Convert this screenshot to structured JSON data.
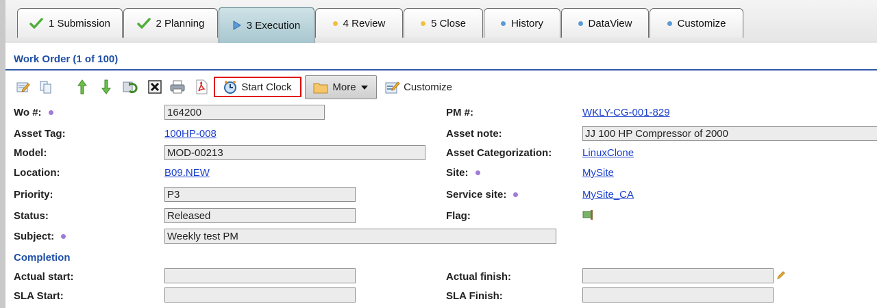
{
  "tabs": [
    {
      "label": "1 Submission",
      "icon": "check-icon",
      "state": "done"
    },
    {
      "label": "2 Planning",
      "icon": "check-icon",
      "state": "done"
    },
    {
      "label": "3 Execution",
      "icon": "play-icon",
      "state": "active"
    },
    {
      "label": "4 Review",
      "icon": "yellow-dot-icon",
      "state": "pending"
    },
    {
      "label": "5 Close",
      "icon": "yellow-dot-icon",
      "state": "pending"
    },
    {
      "label": "History",
      "icon": "blue-dot-icon",
      "state": "info"
    },
    {
      "label": "DataView",
      "icon": "blue-dot-icon",
      "state": "info"
    },
    {
      "label": "Customize",
      "icon": "blue-dot-icon",
      "state": "info"
    }
  ],
  "section_title": "Work Order (1 of 100)",
  "toolbar": {
    "icons": [
      "edit-icon",
      "copy-icon",
      "move-up-icon",
      "move-down-icon",
      "refresh-icon",
      "delete-icon",
      "print-icon",
      "pdf-icon"
    ],
    "start_clock_label": "Start Clock",
    "more_label": "More",
    "customize_label": "Customize"
  },
  "form": {
    "wo_label": "Wo #:",
    "wo_value": "164200",
    "pm_label": "PM #:",
    "pm_value": "WKLY-CG-001-829",
    "asset_tag_label": "Asset Tag:",
    "asset_tag_value": "100HP-008",
    "asset_note_label": "Asset note:",
    "asset_note_value": "JJ 100 HP Compressor of 2000",
    "model_label": "Model:",
    "model_value": "MOD-00213",
    "asset_cat_label": "Asset Categorization:",
    "asset_cat_value": "LinuxClone",
    "location_label": "Location:",
    "location_value": "B09.NEW",
    "site_label": "Site:",
    "site_value": "MySite",
    "priority_label": "Priority:",
    "priority_value": "P3",
    "service_site_label": "Service site:",
    "service_site_value": "MySite_CA",
    "status_label": "Status:",
    "status_value": "Released",
    "flag_label": "Flag:",
    "subject_label": "Subject:",
    "subject_value": "Weekly test PM"
  },
  "completion": {
    "title": "Completion",
    "actual_start_label": "Actual start:",
    "actual_start_value": "",
    "actual_finish_label": "Actual finish:",
    "actual_finish_value": "",
    "sla_start_label": "SLA Start:",
    "sla_start_value": "",
    "sla_finish_label": "SLA Finish:",
    "sla_finish_value": ""
  },
  "colors": {
    "accent": "#1f4fa5",
    "link": "#1a3fcb",
    "required_dot": "#a07bd6",
    "highlight": "#e00000"
  }
}
